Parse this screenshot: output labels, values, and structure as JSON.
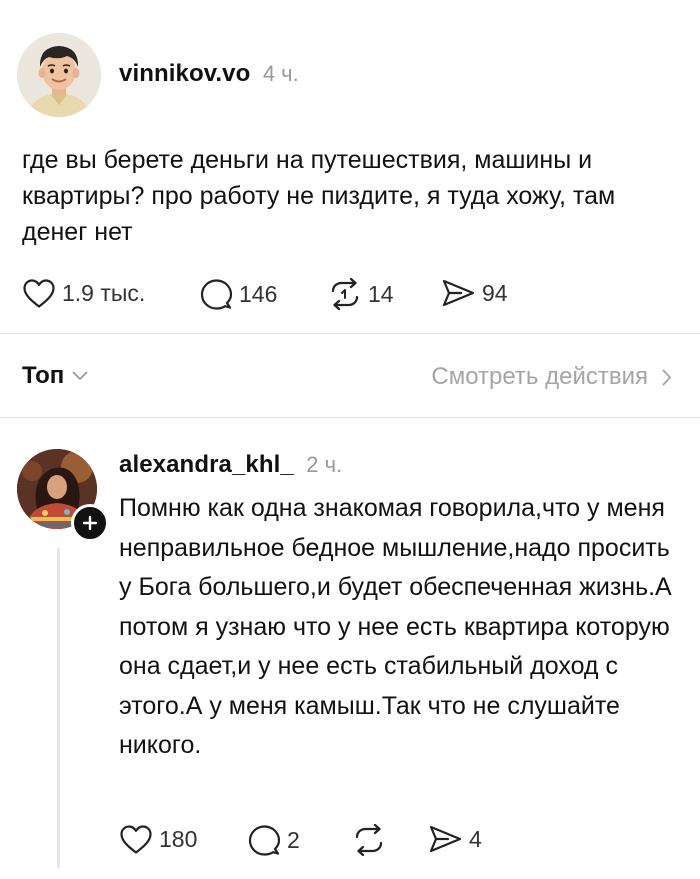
{
  "post": {
    "username": "vinnikov.vo",
    "time": "4 ч.",
    "text": "где вы берете деньги на путешествия, машины и квартиры? про работу не пиздите, я туда хожу, там денег нет",
    "likes": "1.9 тыс.",
    "replies": "146",
    "reposts": "14",
    "shares": "94"
  },
  "sort": {
    "label": "Топ",
    "activity_link": "Смотреть действия"
  },
  "reply": {
    "username": "alexandra_khl_",
    "time": "2 ч.",
    "text": "Помню как одна знакомая говорила,что у меня неправильное бедное мышление,надо просить у Бога большего,и будет обеспеченная жизнь.А потом я узнаю что у нее есть квартира которую она сдает,и у нее есть стабильный доход с этого.А у меня камыш.Так что не слушайте никого.",
    "likes": "180",
    "replies": "2",
    "shares": "4"
  },
  "icons": {
    "like": "heart-icon",
    "reply": "speech-bubble-icon",
    "repost": "repost-arrows-icon",
    "share": "paper-plane-icon",
    "sort_chevron": "chevron-down-icon",
    "activity_chevron": "chevron-right-icon",
    "follow": "plus-icon"
  },
  "colors": {
    "text": "#121212",
    "secondary": "#9a9a9a",
    "divider": "#e3e3e3",
    "badge": "#111111"
  }
}
